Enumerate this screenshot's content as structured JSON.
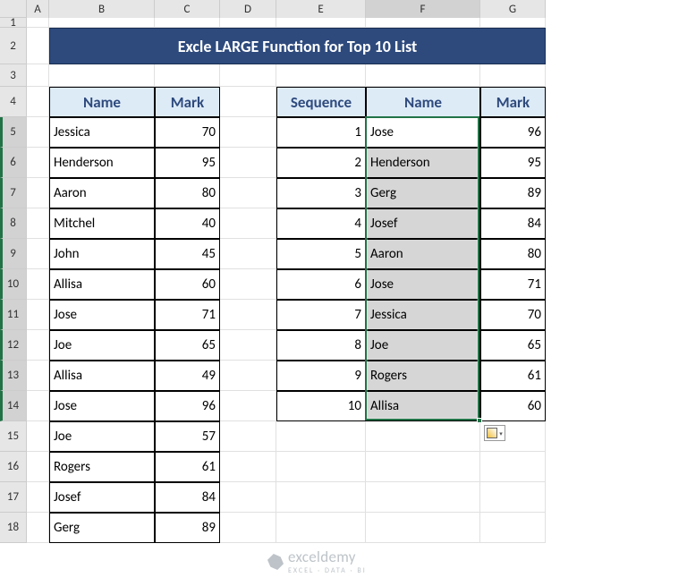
{
  "title": "Excle LARGE Function for Top 10 List",
  "columns": [
    "A",
    "B",
    "C",
    "D",
    "E",
    "F",
    "G"
  ],
  "columnWidths": {
    "rowHdr": 30,
    "A": 25,
    "B": 118,
    "C": 73,
    "D": 63,
    "E": 100,
    "F": 128,
    "G": 73
  },
  "rowHeights": {
    "hdr": 20,
    "1": 11,
    "2": 41,
    "3": 25,
    "default": 34
  },
  "rows": [
    1,
    2,
    3,
    4,
    5,
    6,
    7,
    8,
    9,
    10,
    11,
    12,
    13,
    14,
    15,
    16,
    17,
    18
  ],
  "selectedRows": [
    5,
    6,
    7,
    8,
    9,
    10,
    11,
    12,
    13,
    14
  ],
  "selectedCol": "F",
  "left": {
    "headers": {
      "name": "Name",
      "mark": "Mark"
    },
    "data": [
      {
        "name": "Jessica",
        "mark": 70
      },
      {
        "name": "Henderson",
        "mark": 95
      },
      {
        "name": "Aaron",
        "mark": 80
      },
      {
        "name": "Mitchel",
        "mark": 40
      },
      {
        "name": "John",
        "mark": 45
      },
      {
        "name": "Allisa",
        "mark": 60
      },
      {
        "name": "Jose",
        "mark": 71
      },
      {
        "name": "Joe",
        "mark": 65
      },
      {
        "name": "Allisa",
        "mark": 49
      },
      {
        "name": "Jose",
        "mark": 96
      },
      {
        "name": "Joe",
        "mark": 57
      },
      {
        "name": "Rogers",
        "mark": 61
      },
      {
        "name": "Josef",
        "mark": 84
      },
      {
        "name": "Gerg",
        "mark": 89
      }
    ]
  },
  "right": {
    "headers": {
      "seq": "Sequence",
      "name": "Name",
      "mark": "Mark"
    },
    "data": [
      {
        "seq": 1,
        "name": "Jose",
        "mark": 96
      },
      {
        "seq": 2,
        "name": "Henderson",
        "mark": 95
      },
      {
        "seq": 3,
        "name": "Gerg",
        "mark": 89
      },
      {
        "seq": 4,
        "name": "Josef",
        "mark": 84
      },
      {
        "seq": 5,
        "name": "Aaron",
        "mark": 80
      },
      {
        "seq": 6,
        "name": "Jose",
        "mark": 71
      },
      {
        "seq": 7,
        "name": "Jessica",
        "mark": 70
      },
      {
        "seq": 8,
        "name": "Joe",
        "mark": 65
      },
      {
        "seq": 9,
        "name": "Rogers",
        "mark": 61
      },
      {
        "seq": 10,
        "name": "Allisa",
        "mark": 60
      }
    ]
  },
  "watermark": {
    "name": "exceldemy",
    "sub": "EXCEL · DATA · BI"
  }
}
